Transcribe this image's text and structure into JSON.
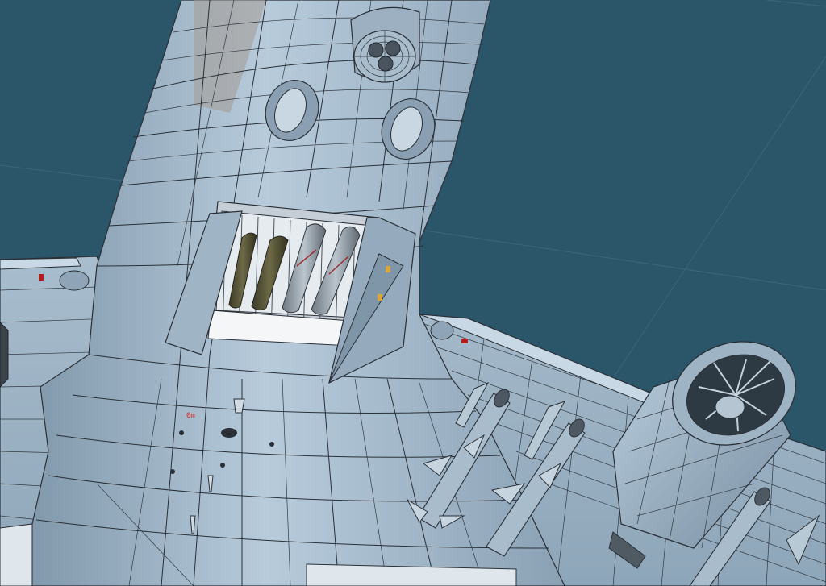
{
  "viewport": {
    "background": "#2b5568",
    "mesh_color": "#9fb6c8",
    "wire_color": "#2a2f36",
    "scale_label": "0m",
    "scale_label_color": "#d22a2a"
  },
  "model": {
    "components": [
      "fuselage",
      "bomb-bay",
      "tail-turret",
      "wing",
      "jet-engine",
      "missiles",
      "windows"
    ],
    "bomb_count": 4,
    "missile_count": 3
  }
}
